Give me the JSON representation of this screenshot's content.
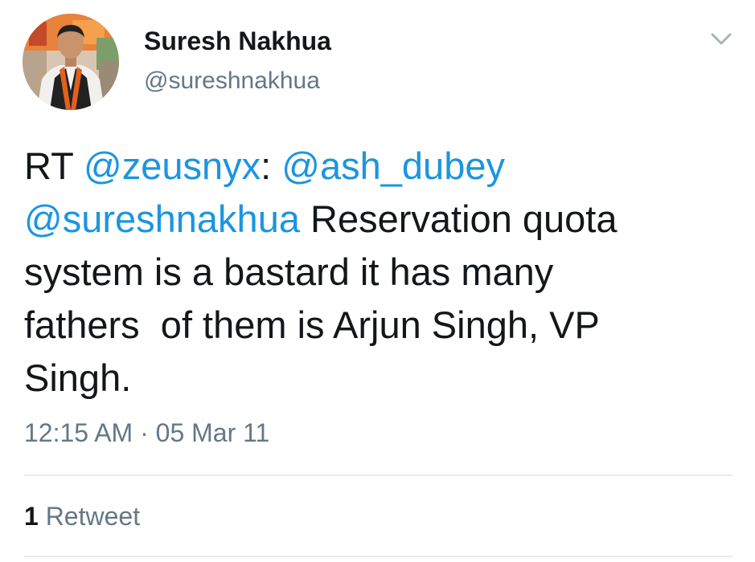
{
  "author": {
    "display_name": "Suresh Nakhua",
    "handle": "@sureshnakhua"
  },
  "tweet": {
    "segments": [
      {
        "type": "text",
        "text": "RT "
      },
      {
        "type": "mention",
        "text": "@zeusnyx"
      },
      {
        "type": "text",
        "text": ": "
      },
      {
        "type": "mention",
        "text": "@ash_dubey"
      },
      {
        "type": "text",
        "text": "\n"
      },
      {
        "type": "mention",
        "text": "@sureshnakhua"
      },
      {
        "type": "text",
        "text": " Reservation quota\nsystem is a bastard it has many\nfathers  of them is Arjun Singh, VP\nSingh."
      }
    ]
  },
  "meta": {
    "time": "12:15 AM",
    "separator": "·",
    "date": "05 Mar 11"
  },
  "stats": {
    "retweet_count": "1",
    "retweet_label": "Retweet"
  },
  "icons": {
    "menu": "chevron-down-icon"
  },
  "colors": {
    "text": "#14171a",
    "secondary": "#657786",
    "link": "#1b95e0",
    "divider": "#e6ecf0"
  }
}
